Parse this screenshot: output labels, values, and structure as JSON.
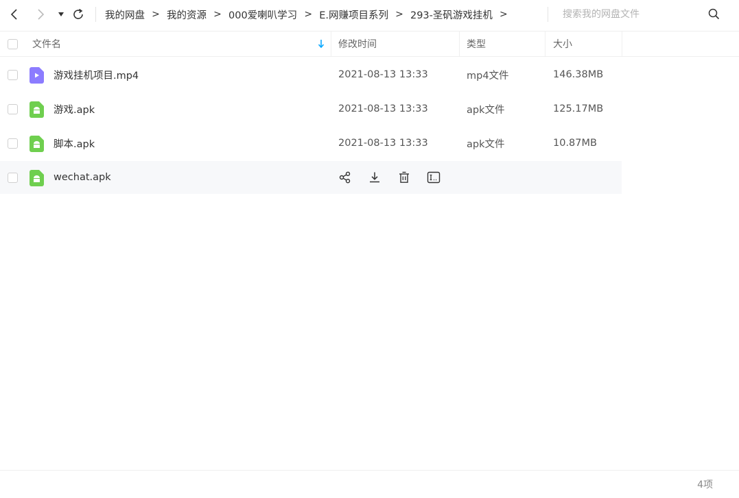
{
  "toolbar": {
    "back": "back-icon",
    "forward": "forward-icon",
    "dropdown": "caret-down-icon",
    "refresh": "refresh-icon"
  },
  "breadcrumb": {
    "items": [
      "我的网盘",
      "我的资源",
      "000爱喇叭学习",
      "E.网赚项目系列",
      "293-圣矾游戏挂机"
    ],
    "separator": ">"
  },
  "search": {
    "placeholder": "搜索我的网盘文件"
  },
  "columns": {
    "name": "文件名",
    "modified": "修改时间",
    "type": "类型",
    "size": "大小"
  },
  "files": [
    {
      "name": "游戏挂机项目.mp4",
      "modified": "2021-08-13 13:33",
      "type": "mp4文件",
      "size": "146.38MB",
      "icon": "video-file-icon"
    },
    {
      "name": "游戏.apk",
      "modified": "2021-08-13 13:33",
      "type": "apk文件",
      "size": "125.17MB",
      "icon": "apk-file-icon"
    },
    {
      "name": "脚本.apk",
      "modified": "2021-08-13 13:33",
      "type": "apk文件",
      "size": "10.87MB",
      "icon": "apk-file-icon"
    },
    {
      "name": "wechat.apk",
      "icon": "apk-file-icon",
      "hover_actions": [
        "share-icon",
        "download-icon",
        "delete-icon",
        "rename-icon"
      ]
    }
  ],
  "footer": {
    "count": "4项"
  },
  "colors": {
    "accent": "#06a7ff",
    "video": "#8c7cff",
    "apk": "#6fcf4f"
  }
}
